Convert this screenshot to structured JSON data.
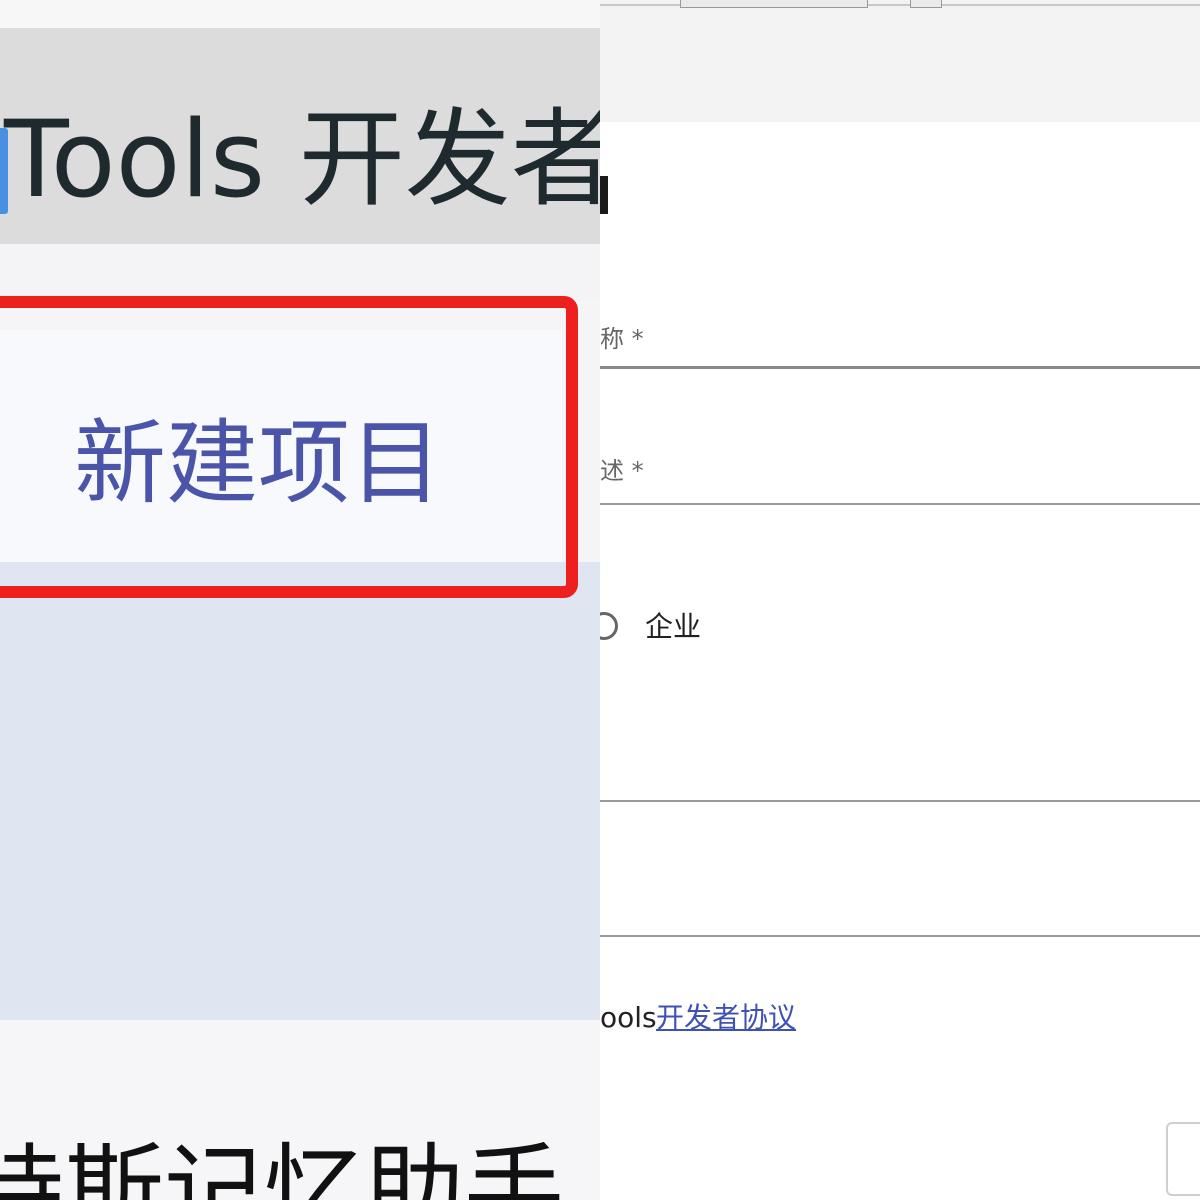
{
  "left_panel": {
    "header_title": "Tools 开发者",
    "new_project_label": "新建项目",
    "project_name": "诗斯记忆助手"
  },
  "right_panel": {
    "field_name_label_fragment": "称 *",
    "field_desc_label_fragment": "述 *",
    "radio_enterprise_label": "企业",
    "agreement_prefix": "ools",
    "agreement_link": "开发者协议"
  },
  "colors": {
    "highlight": "#ee1f1f",
    "link": "#3f51b5",
    "header_band": "#dcdcdc",
    "selection_band": "#dfe5f1"
  }
}
